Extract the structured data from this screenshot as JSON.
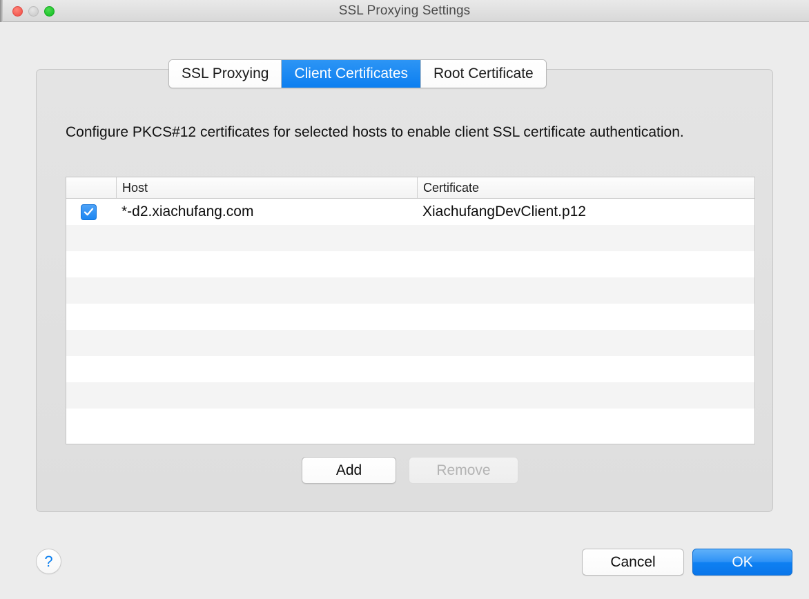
{
  "window": {
    "title": "SSL Proxying Settings",
    "traffic_lights": [
      {
        "name": "close",
        "color": "#f25a51"
      },
      {
        "name": "minimize",
        "color": "#cfcfcf"
      },
      {
        "name": "zoom",
        "color": "#1fc32c"
      }
    ]
  },
  "tabs": [
    {
      "label": "SSL Proxying",
      "active": false
    },
    {
      "label": "Client Certificates",
      "active": true
    },
    {
      "label": "Root Certificate",
      "active": false
    }
  ],
  "description": "Configure PKCS#12 certificates for selected hosts to enable client SSL certificate authentication.",
  "table": {
    "columns": [
      "",
      "Host",
      "Certificate"
    ],
    "rows": [
      {
        "checked": true,
        "host": "*-d2.xiachufang.com",
        "certificate": "XiachufangDevClient.p12"
      }
    ],
    "empty_row_count": 8
  },
  "list_actions": {
    "add_label": "Add",
    "remove_label": "Remove",
    "remove_enabled": false
  },
  "footer": {
    "help_label": "?",
    "cancel_label": "Cancel",
    "ok_label": "OK"
  },
  "colors": {
    "accent_blue": "#0b7ef0",
    "window_bg": "#ececec",
    "panel_bg": "#e0e0e0",
    "row_alt": "#f4f4f4"
  }
}
